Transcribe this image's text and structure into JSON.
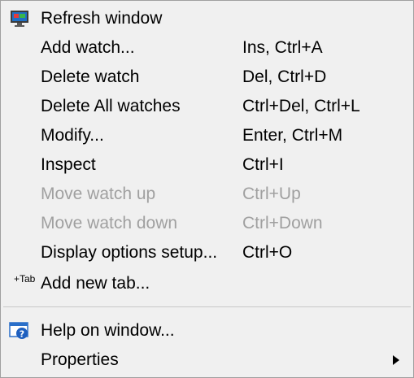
{
  "menu": {
    "items": [
      {
        "label": "Refresh window",
        "shortcut": "",
        "icon": "monitor-refresh-icon",
        "enabled": true
      },
      {
        "label": "Add watch...",
        "shortcut": "Ins, Ctrl+A",
        "enabled": true
      },
      {
        "label": "Delete watch",
        "shortcut": "Del, Ctrl+D",
        "enabled": true
      },
      {
        "label": "Delete All watches",
        "shortcut": "Ctrl+Del, Ctrl+L",
        "enabled": true
      },
      {
        "label": "Modify...",
        "shortcut": "Enter, Ctrl+M",
        "enabled": true
      },
      {
        "label": "Inspect",
        "shortcut": "Ctrl+I",
        "enabled": true
      },
      {
        "label": "Move watch up",
        "shortcut": "Ctrl+Up",
        "enabled": false
      },
      {
        "label": "Move watch down",
        "shortcut": "Ctrl+Down",
        "enabled": false
      },
      {
        "label": "Display options setup...",
        "shortcut": "Ctrl+O",
        "enabled": true
      },
      {
        "label": "Add new tab...",
        "shortcut": "",
        "icon_text": "+Tab",
        "enabled": true
      },
      {
        "label": "Help on window...",
        "shortcut": "",
        "icon": "help-window-icon",
        "enabled": true
      },
      {
        "label": "Properties",
        "shortcut": "",
        "submenu": true,
        "enabled": true
      }
    ]
  },
  "colors": {
    "background": "#f0f0f0",
    "text": "#000000",
    "disabled_text": "#a0a0a0",
    "separator": "#c8c8c8"
  }
}
